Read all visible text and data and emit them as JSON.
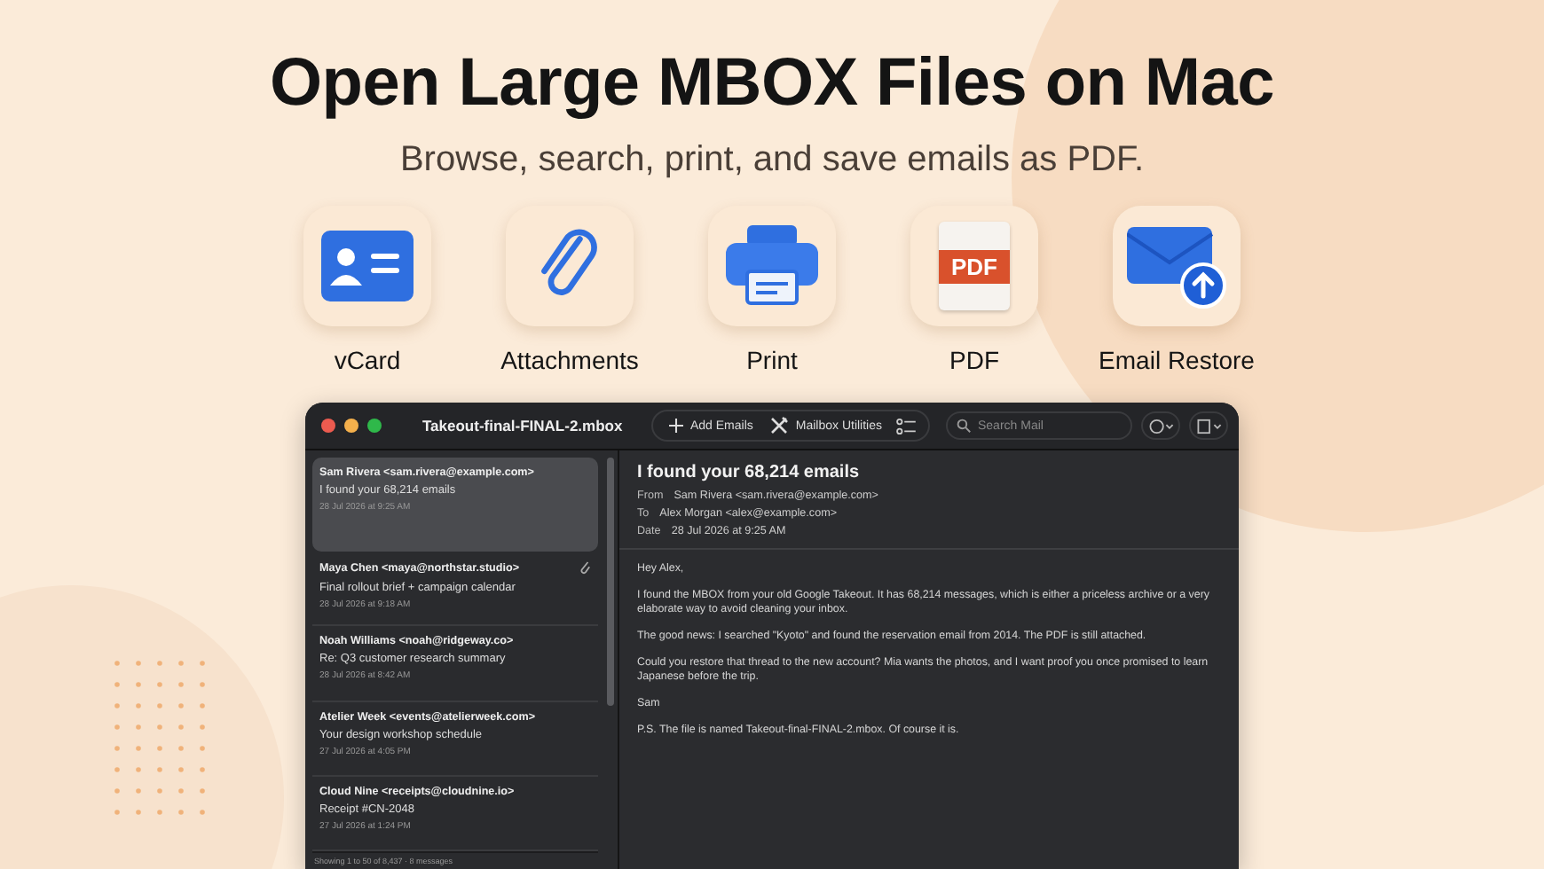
{
  "headline": "Open Large MBOX Files on Mac",
  "subtitle": "Browse, search, print, and save emails as PDF.",
  "features": [
    {
      "kind": "vcard",
      "label": "vCard"
    },
    {
      "kind": "clip",
      "label": "Attachments"
    },
    {
      "kind": "print",
      "label": "Print"
    },
    {
      "kind": "pdf",
      "label": "PDF",
      "icon_text": "PDF"
    },
    {
      "kind": "restore",
      "label": "Email Restore"
    }
  ],
  "window": {
    "title": "Takeout-final-FINAL-2.mbox",
    "toolbar": [
      "Add Emails",
      "Mailbox Utilities"
    ],
    "search": {
      "placeholder": "Search Mail"
    }
  },
  "messages": [
    {
      "sender": "Sam Rivera <sam.rivera@example.com>",
      "subject": "I found your 68,214 emails",
      "date": "28 Jul 2026 at 9:25 AM",
      "selected": true,
      "attachment": false
    },
    {
      "sender": "Maya Chen <maya@northstar.studio>",
      "subject": "Final rollout brief + campaign calendar",
      "date": "28 Jul 2026 at 9:18 AM",
      "selected": false,
      "attachment": true
    },
    {
      "sender": "Noah Williams <noah@ridgeway.co>",
      "subject": "Re: Q3 customer research summary",
      "date": "28 Jul 2026 at 8:42 AM",
      "selected": false,
      "attachment": false
    },
    {
      "sender": "Atelier Week <events@atelierweek.com>",
      "subject": "Your design workshop schedule",
      "date": "27 Jul 2026 at 4:05 PM",
      "selected": false,
      "attachment": false
    },
    {
      "sender": "Cloud Nine <receipts@cloudnine.io>",
      "subject": "Receipt #CN-2048",
      "date": "27 Jul 2026 at 1:24 PM",
      "selected": false,
      "attachment": false
    }
  ],
  "list_footer": "Showing 1 to 50 of 8,437 · 8 messages",
  "reader": {
    "subject": "I found your 68,214 emails",
    "fields": [
      {
        "label": "From",
        "value": "Sam Rivera <sam.rivera@example.com>"
      },
      {
        "label": "To",
        "value": "Alex Morgan <alex@example.com>"
      },
      {
        "label": "Date",
        "value": "28 Jul 2026 at 9:25 AM"
      }
    ],
    "body": [
      "Hey Alex,",
      "I found the MBOX from your old Google Takeout. It has 68,214 messages, which is either a priceless archive or a very elaborate way to avoid cleaning your inbox.",
      "The good news: I searched \"Kyoto\" and found the reservation email from 2014. The PDF is still attached.",
      "Could you restore that thread to the new account? Mia wants the photos, and I want proof you once promised to learn Japanese before the trip.",
      "Sam",
      "P.S. The file is named Takeout-final-FINAL-2.mbox. Of course it is."
    ]
  }
}
